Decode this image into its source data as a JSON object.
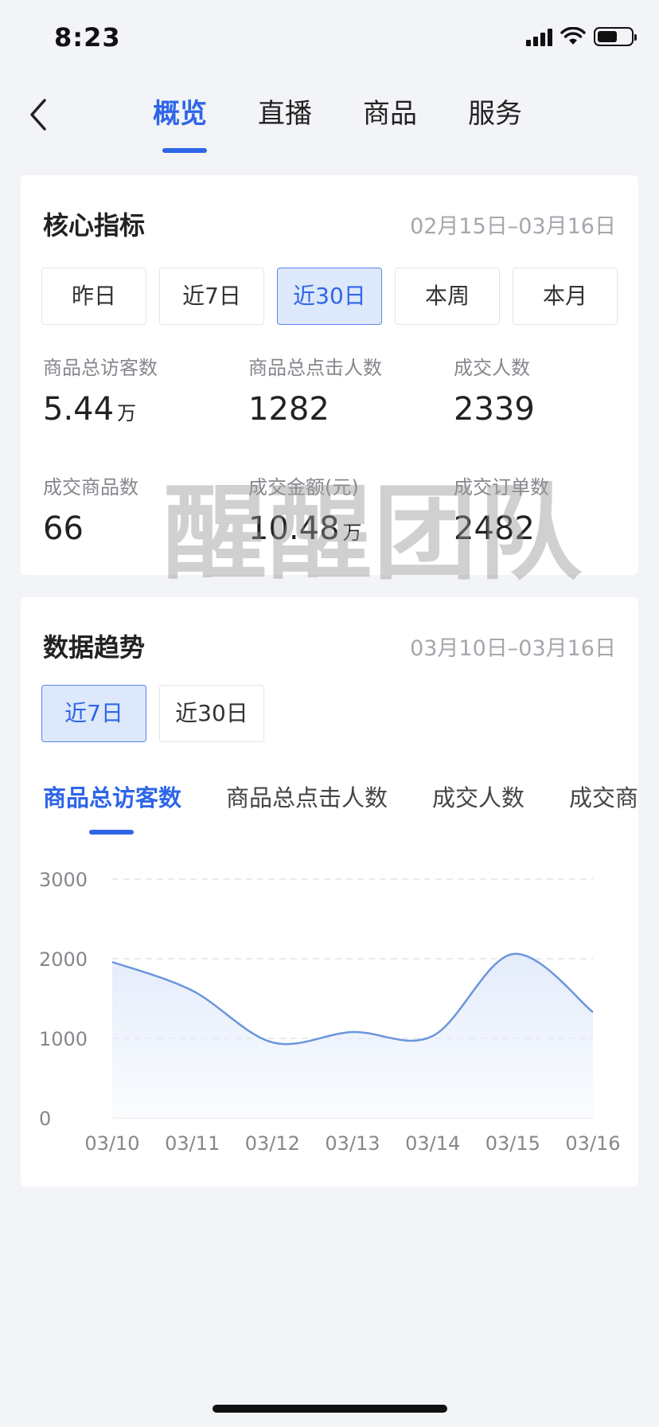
{
  "status_bar": {
    "time": "8:23"
  },
  "nav": {
    "tabs": [
      {
        "label": "概览",
        "active": true
      },
      {
        "label": "直播",
        "active": false
      },
      {
        "label": "商品",
        "active": false
      },
      {
        "label": "服务",
        "active": false
      }
    ]
  },
  "core_metrics": {
    "title": "核心指标",
    "date_range": "02月15日–03月16日",
    "ranges": [
      {
        "label": "昨日",
        "active": false
      },
      {
        "label": "近7日",
        "active": false
      },
      {
        "label": "近30日",
        "active": true
      },
      {
        "label": "本周",
        "active": false
      },
      {
        "label": "本月",
        "active": false
      }
    ],
    "items": [
      {
        "label": "商品总访客数",
        "value": "5.44",
        "unit": "万"
      },
      {
        "label": "商品总点击人数",
        "value": "1282",
        "unit": ""
      },
      {
        "label": "成交人数",
        "value": "2339",
        "unit": ""
      },
      {
        "label": "成交商品数",
        "value": "66",
        "unit": ""
      },
      {
        "label": "成交金额(元)",
        "value": "10.48",
        "unit": "万"
      },
      {
        "label": "成交订单数",
        "value": "2482",
        "unit": ""
      }
    ]
  },
  "watermark": "醒醒团队",
  "trend": {
    "title": "数据趋势",
    "date_range": "03月10日–03月16日",
    "ranges": [
      {
        "label": "近7日",
        "active": true
      },
      {
        "label": "近30日",
        "active": false
      }
    ],
    "metric_tabs": [
      {
        "label": "商品总访客数",
        "active": true
      },
      {
        "label": "商品总点击人数",
        "active": false
      },
      {
        "label": "成交人数",
        "active": false
      },
      {
        "label": "成交商品数",
        "active": false
      }
    ]
  },
  "colors": {
    "accent": "#2f66e8",
    "line": "#6b96dc",
    "fill": "#e4ecfb"
  },
  "chart_data": {
    "type": "area",
    "x": [
      "03/10",
      "03/11",
      "03/12",
      "03/13",
      "03/14",
      "03/15",
      "03/16"
    ],
    "series": [
      {
        "values": [
          1960,
          1600,
          950,
          1080,
          1030,
          2060,
          1330
        ]
      }
    ],
    "yticks": [
      "0",
      "1000",
      "2000",
      "3000"
    ],
    "ylim": [
      0,
      3000
    ],
    "grid": true
  }
}
